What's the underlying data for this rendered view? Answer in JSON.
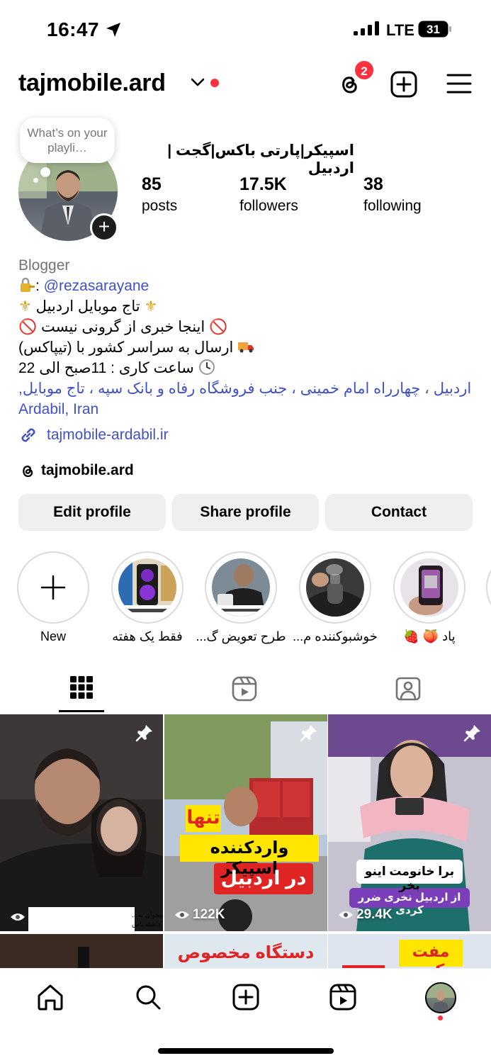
{
  "status_bar": {
    "time": "16:47",
    "network": "LTE",
    "battery": "31"
  },
  "header": {
    "username": "tajmobile.ard",
    "notification_count": "2"
  },
  "note": {
    "text": "What’s on your playli…"
  },
  "profile": {
    "display_name": "اسپیکر|پارتی باکس|گجت |اردبیل",
    "stats": [
      {
        "value": "85",
        "label": "posts"
      },
      {
        "value": "17.5K",
        "label": "followers"
      },
      {
        "value": "38",
        "label": "following"
      }
    ],
    "bio": {
      "category": "Blogger",
      "mention_prefix": ": ",
      "mention": "@rezasarayane",
      "line_shop": "تاج موبایل اردبیل",
      "line_no_price": "اینجا خبری از گرونی نیست",
      "line_shipping": "ارسال به سراسر کشور با (تیپاکس)",
      "line_hours": "ساعت کاری : 11صبح الی 22",
      "address": "اردبیل ، چهارراه امام خمینی ، جنب فروشگاه رفاه و بانک سپه ، تاج موبایل,",
      "city": "Ardabil, Iran"
    },
    "link": "tajmobile-ardabil.ir",
    "threads_handle": "tajmobile.ard"
  },
  "buttons": {
    "edit": "Edit profile",
    "share": "Share profile",
    "contact": "Contact"
  },
  "highlights": [
    {
      "label": "New"
    },
    {
      "label": "فقط یک هفته"
    },
    {
      "label": "طرح تعویض گ..."
    },
    {
      "label": "خوشبوکننده م..."
    },
    {
      "label": "پاد 🍑 🍓"
    }
  ],
  "posts": [
    {
      "views": "",
      "caption": "یادت باشه زمانی که میخوای به... مدت تا گردن میری تو فشار اما صبر داشته باش"
    },
    {
      "views": "122K",
      "overlay": [
        "تنها",
        "واردکننده اسپیکر",
        "در اردبیل"
      ]
    },
    {
      "views": "29.4K",
      "overlay": [
        "برا خانومت اینو بخر",
        "از اردبیل نخری ضرر کردی"
      ]
    }
  ],
  "posts_row2": [
    {
      "overlay": ""
    },
    {
      "overlay": "دستگاه مخصوص"
    },
    {
      "overlay": "مفت کده"
    }
  ],
  "colors": {
    "accent_link": "#4150c8",
    "badge": "#ff3040",
    "button_bg": "#efefef"
  }
}
